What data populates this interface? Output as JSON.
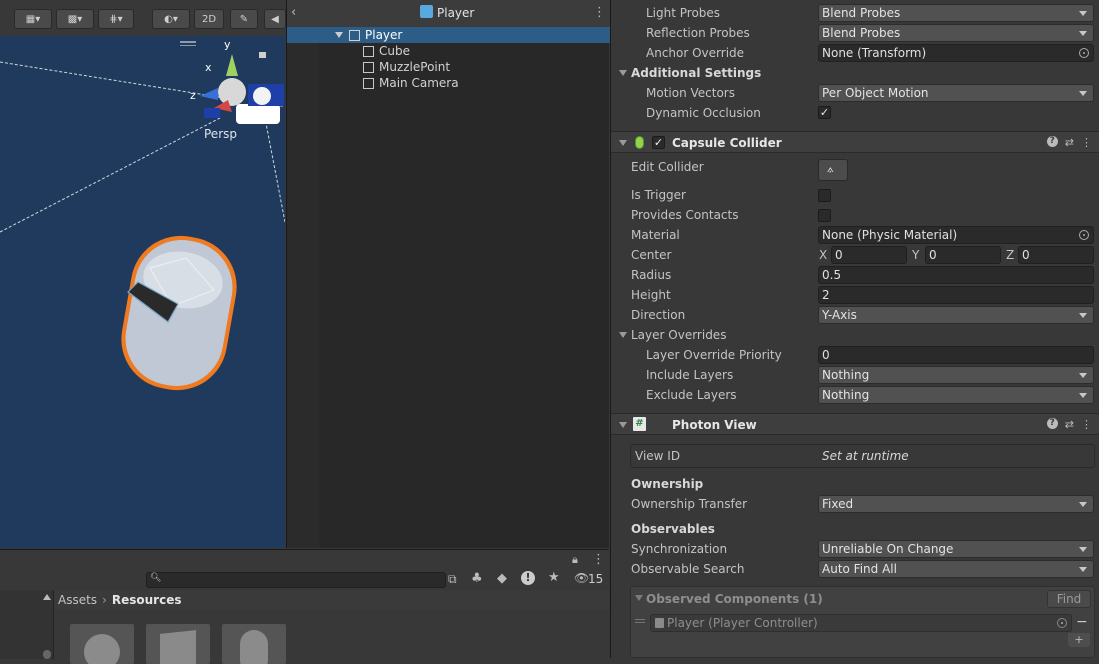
{
  "scene": {
    "toolbar_2d": "2D",
    "gizmo_y": "y",
    "gizmo_x": "x",
    "gizmo_z": "z",
    "persp_label": "Persp"
  },
  "hierarchy": {
    "title": "Player",
    "items": [
      {
        "label": "Player",
        "selected": true
      },
      {
        "label": "Cube"
      },
      {
        "label": "MuzzlePoint"
      },
      {
        "label": "Main Camera"
      }
    ]
  },
  "project": {
    "visible_count": "15",
    "breadcrumb_root": "Assets",
    "breadcrumb_current": "Resources",
    "search_value": ""
  },
  "inspector": {
    "renderer_rows": [
      {
        "label": "Light Probes",
        "value": "Blend Probes",
        "kind": "dropdown"
      },
      {
        "label": "Reflection Probes",
        "value": "Blend Probes",
        "kind": "dropdown"
      },
      {
        "label": "Anchor Override",
        "value": "None (Transform)",
        "kind": "object"
      }
    ],
    "additional_settings": {
      "title": "Additional Settings",
      "motion_vectors_label": "Motion Vectors",
      "motion_vectors_value": "Per Object Motion",
      "dynamic_occlusion_label": "Dynamic Occlusion",
      "dynamic_occlusion_checked": true
    },
    "capsule_collider": {
      "title": "Capsule Collider",
      "enabled": true,
      "edit_collider_label": "Edit Collider",
      "is_trigger_label": "Is Trigger",
      "is_trigger": false,
      "provides_contacts_label": "Provides Contacts",
      "provides_contacts": false,
      "material_label": "Material",
      "material_value": "None (Physic Material)",
      "center_label": "Center",
      "center": {
        "x_label": "X",
        "x": "0",
        "y_label": "Y",
        "y": "0",
        "z_label": "Z",
        "z": "0"
      },
      "radius_label": "Radius",
      "radius": "0.5",
      "height_label": "Height",
      "height": "2",
      "direction_label": "Direction",
      "direction": "Y-Axis",
      "layer_overrides_title": "Layer Overrides",
      "layer_override_priority_label": "Layer Override Priority",
      "layer_override_priority": "0",
      "include_layers_label": "Include Layers",
      "include_layers": "Nothing",
      "exclude_layers_label": "Exclude Layers",
      "exclude_layers": "Nothing"
    },
    "photon_view": {
      "title": "Photon View",
      "view_id_label": "View ID",
      "view_id_value": "Set at runtime",
      "ownership_title": "Ownership",
      "ownership_transfer_label": "Ownership Transfer",
      "ownership_transfer": "Fixed",
      "observables_title": "Observables",
      "synchronization_label": "Synchronization",
      "synchronization": "Unreliable On Change",
      "observable_search_label": "Observable Search",
      "observable_search": "Auto Find All",
      "observed_components_title": "Observed Components (1)",
      "find_button": "Find",
      "observed_item": "Player (Player Controller)"
    }
  },
  "colors": {
    "selection": "#2c5d87",
    "capsule_outline": "#f07a20",
    "scene_bg": "#1f3a5c"
  }
}
